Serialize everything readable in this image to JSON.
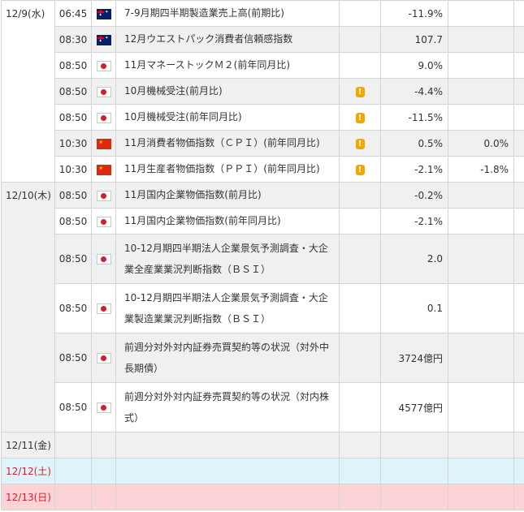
{
  "days": [
    {
      "date": "12/9(水)",
      "rows": [
        {
          "time": "06:45",
          "flag": "australia-flag",
          "name": "7-9月期四半期製造業売上高(前期比)",
          "warn": false,
          "value": "-11.9%",
          "forecast": ""
        },
        {
          "time": "08:30",
          "flag": "australia-flag",
          "name": "12月ウエストパック消費者信頼感指数",
          "warn": false,
          "value": "107.7",
          "forecast": ""
        },
        {
          "time": "08:50",
          "flag": "japan-flag",
          "name": "11月マネーストックＭ２(前年同月比)",
          "warn": false,
          "value": "9.0%",
          "forecast": ""
        },
        {
          "time": "08:50",
          "flag": "japan-flag",
          "name": "10月機械受注(前月比)",
          "warn": true,
          "value": "-4.4%",
          "forecast": ""
        },
        {
          "time": "08:50",
          "flag": "japan-flag",
          "name": "10月機械受注(前年同月比)",
          "warn": true,
          "value": "-11.5%",
          "forecast": ""
        },
        {
          "time": "10:30",
          "flag": "china-flag",
          "name": "11月消費者物価指数（ＣＰＩ）(前年同月比)",
          "warn": true,
          "value": "0.5%",
          "forecast": "0.0%"
        },
        {
          "time": "10:30",
          "flag": "china-flag",
          "name": "11月生産者物価指数（ＰＰＩ）(前年同月比)",
          "warn": true,
          "value": "-2.1%",
          "forecast": "-1.8%"
        }
      ]
    },
    {
      "date": "12/10(木)",
      "rows": [
        {
          "time": "08:50",
          "flag": "japan-flag",
          "name": "11月国内企業物価指数(前月比)",
          "warn": false,
          "value": "-0.2%",
          "forecast": ""
        },
        {
          "time": "08:50",
          "flag": "japan-flag",
          "name": "11月国内企業物価指数(前年同月比)",
          "warn": false,
          "value": "-2.1%",
          "forecast": ""
        },
        {
          "time": "08:50",
          "flag": "japan-flag",
          "name": "10-12月期四半期法人企業景気予測調査・大企業全産業業況判断指数（ＢＳＩ）",
          "warn": false,
          "value": "2.0",
          "forecast": ""
        },
        {
          "time": "08:50",
          "flag": "japan-flag",
          "name": "10-12月期四半期法人企業景気予測調査・大企業製造業業況判断指数（ＢＳＩ）",
          "warn": false,
          "value": "0.1",
          "forecast": ""
        },
        {
          "time": "08:50",
          "flag": "japan-flag",
          "name": "前週分対外対内証券売買契約等の状況（対外中長期債）",
          "warn": false,
          "value": "3724億円",
          "forecast": ""
        },
        {
          "time": "08:50",
          "flag": "japan-flag",
          "name": "前週分対外対内証券売買契約等の状況（対内株式）",
          "warn": false,
          "value": "4577億円",
          "forecast": ""
        }
      ]
    }
  ],
  "empty_days": [
    {
      "date": "12/11(金)",
      "type": "weekday"
    },
    {
      "date": "12/12(土)",
      "type": "saturday"
    },
    {
      "date": "12/13(日)",
      "type": "sunday"
    }
  ],
  "colors": {
    "saturday_bg": "#dff3fb",
    "sunday_bg": "#fcd3d6",
    "holiday_text": "#d21f2f",
    "warn": "#f5a400"
  }
}
